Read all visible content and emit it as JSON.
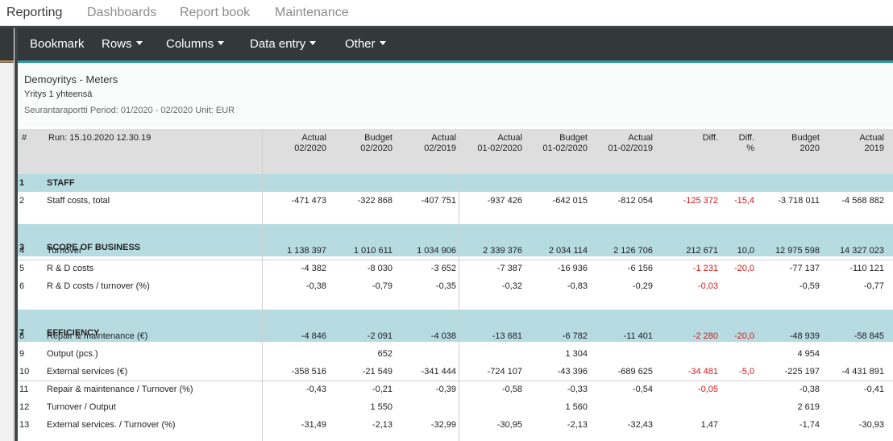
{
  "nav": {
    "tabs": [
      {
        "label": "Reporting",
        "active": true
      },
      {
        "label": "Dashboards",
        "active": false
      },
      {
        "label": "Report book",
        "active": false
      },
      {
        "label": "Maintenance",
        "active": false
      }
    ]
  },
  "toolbar": {
    "bookmark": "Bookmark",
    "rows": "Rows",
    "columns": "Columns",
    "data_entry": "Data entry",
    "other": "Other"
  },
  "report": {
    "company": "Demoyritys - Meters",
    "unit": "Yritys 1 yhteensä",
    "period": "Seurantaraportti Period: 01/2020 - 02/2020 Unit: EUR"
  },
  "table": {
    "num_header": "#",
    "run_label": "Run: 15.10.2020 12.30.19",
    "columns": [
      {
        "line1": "Actual",
        "line2": "02/2020"
      },
      {
        "line1": "Budget",
        "line2": "02/2020"
      },
      {
        "line1": "Actual",
        "line2": "02/2019"
      },
      {
        "line1": "Actual",
        "line2": "01-02/2020"
      },
      {
        "line1": "Budget",
        "line2": "01-02/2020"
      },
      {
        "line1": "Actual",
        "line2": "01-02/2019"
      },
      {
        "line1": "",
        "line2": "Diff."
      },
      {
        "line1": "Diff.",
        "line2": "%"
      },
      {
        "line1": "Budget",
        "line2": "2020"
      },
      {
        "line1": "Actual",
        "line2": "2019"
      }
    ],
    "rows": [
      {
        "num": "1",
        "label": "STAFF",
        "section": true,
        "values": [
          "",
          "",
          "",
          "",
          "",
          "",
          "",
          "",
          "",
          ""
        ]
      },
      {
        "num": "2",
        "label": "Staff costs, total",
        "section": false,
        "values": [
          "-471 473",
          "-322 868",
          "-407 751",
          "-937 426",
          "-642 015",
          "-812 054",
          "-125 372",
          "-15,4",
          "-3 718 011",
          "-4 568 882"
        ]
      },
      {
        "num": "3",
        "label": "SCOPE OF BUSINESS",
        "section": true,
        "values": [
          "",
          "",
          "",
          "",
          "",
          "",
          "",
          "",
          "",
          ""
        ]
      },
      {
        "num": "4",
        "label": "Turnover",
        "section": false,
        "values": [
          "1 138 397",
          "1 010 611",
          "1 034 906",
          "2 339 376",
          "2 034 114",
          "2 126 706",
          "212 671",
          "10,0",
          "12 975 598",
          "14 327 023"
        ]
      },
      {
        "num": "5",
        "label": "R & D costs",
        "section": false,
        "values": [
          "-4 382",
          "-8 030",
          "-3 652",
          "-7 387",
          "-16 936",
          "-6 156",
          "-1 231",
          "-20,0",
          "-77 137",
          "-110 121"
        ]
      },
      {
        "num": "6",
        "label": "R & D costs / turnover (%)",
        "section": false,
        "values": [
          "-0,38",
          "-0,79",
          "-0,35",
          "-0,32",
          "-0,83",
          "-0,29",
          "-0,03",
          "",
          "-0,59",
          "-0,77"
        ]
      },
      {
        "num": "7",
        "label": "EFFICIENCY",
        "section": true,
        "values": [
          "",
          "",
          "",
          "",
          "",
          "",
          "",
          "",
          "",
          ""
        ]
      },
      {
        "num": "8",
        "label": "Repair & maintenance (€)",
        "section": false,
        "values": [
          "-4 846",
          "-2 091",
          "-4 038",
          "-13 681",
          "-6 782",
          "-11 401",
          "-2 280",
          "-20,0",
          "-48 939",
          "-58 845"
        ]
      },
      {
        "num": "9",
        "label": "Output (pcs.)",
        "section": false,
        "values": [
          "",
          "652",
          "",
          "",
          "1 304",
          "",
          "",
          "",
          "4 954",
          ""
        ]
      },
      {
        "num": "10",
        "label": "External services (€)",
        "section": false,
        "values": [
          "-358 516",
          "-21 549",
          "-341 444",
          "-724 107",
          "-43 396",
          "-689 625",
          "-34 481",
          "-5,0",
          "-225 197",
          "-4 431 891"
        ]
      },
      {
        "num": "11",
        "label": "Repair & maintenance / Turnover (%)",
        "section": false,
        "values": [
          "-0,43",
          "-0,21",
          "-0,39",
          "-0,58",
          "-0,33",
          "-0,54",
          "-0,05",
          "",
          "-0,38",
          "-0,41"
        ]
      },
      {
        "num": "12",
        "label": "Turnover / Output",
        "section": false,
        "values": [
          "",
          "1 550",
          "",
          "",
          "1 560",
          "",
          "",
          "",
          "2 619",
          ""
        ]
      },
      {
        "num": "13",
        "label": "External services. / Turnover (%)",
        "section": false,
        "values": [
          "-31,49",
          "-2,13",
          "-32,99",
          "-30,95",
          "-2,13",
          "-32,43",
          "1,47",
          "",
          "-1,74",
          "-30,93"
        ]
      }
    ]
  },
  "colors": {
    "toolbar_bg": "#33383b",
    "accent_teal": "#2e9aa1",
    "section_band": "#b6dce2",
    "header_bg": "#dedede",
    "negative_diff": "#d51a1a"
  }
}
